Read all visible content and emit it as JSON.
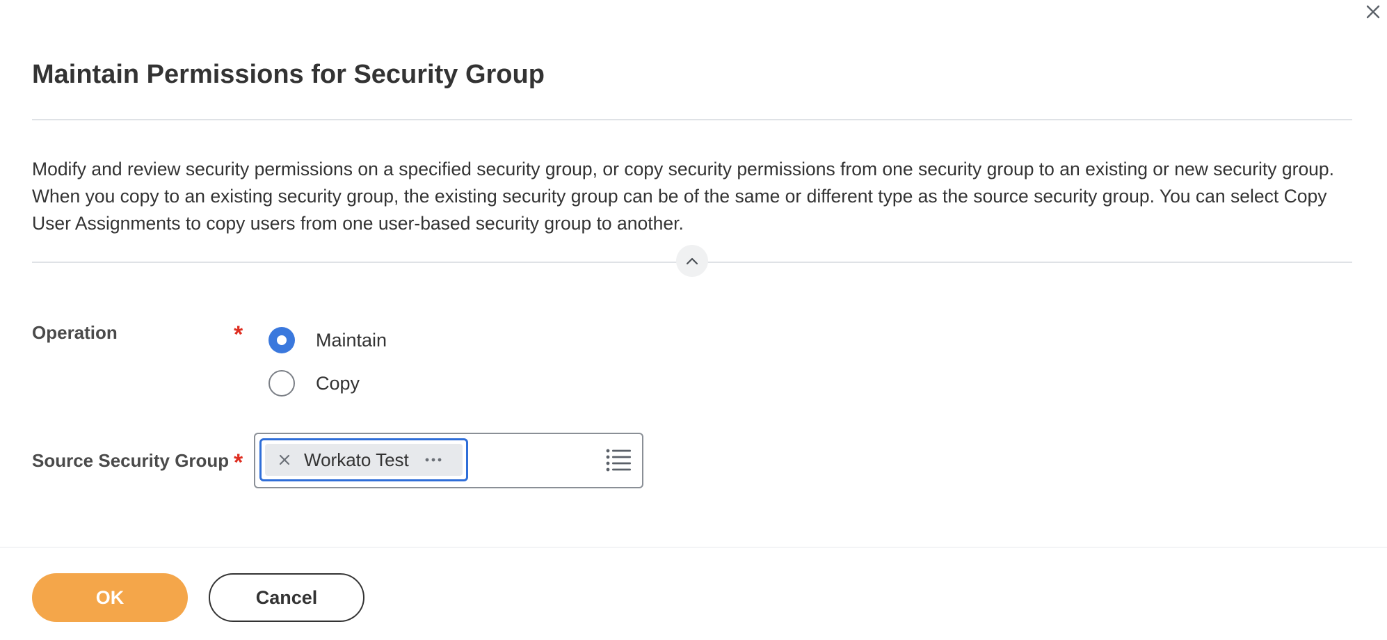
{
  "dialog": {
    "title": "Maintain Permissions for Security Group",
    "description": "Modify and review security permissions on a specified security group, or copy security permissions from one security group to an existing or new security group. When you copy to an existing security group, the existing security group can be of the same or different type as the source security group. You can select Copy User Assignments to copy users from one user-based security group to another.",
    "close_icon": "close-icon",
    "collapse_icon": "chevron-up-icon"
  },
  "form": {
    "operation": {
      "label": "Operation",
      "required_marker": "*",
      "options": [
        {
          "label": "Maintain",
          "selected": true
        },
        {
          "label": "Copy",
          "selected": false
        }
      ]
    },
    "source_security_group": {
      "label": "Source Security Group",
      "required_marker": "*",
      "selected_item": "Workato Test",
      "remove_icon": "x-icon",
      "more_icon": "ellipsis-icon",
      "prompt_icon": "list-icon"
    }
  },
  "footer": {
    "ok_label": "OK",
    "cancel_label": "Cancel"
  },
  "colors": {
    "primary_button": "#f4a64a",
    "radio_selected": "#3a78dd",
    "focus_border": "#2f6ed8",
    "required": "#de2e21"
  }
}
